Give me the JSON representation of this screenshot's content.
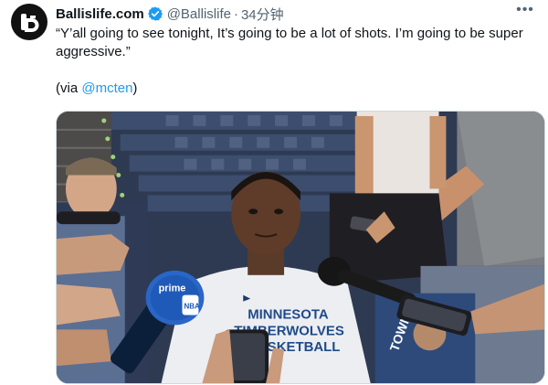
{
  "tweet": {
    "author_name": "Ballislife.com",
    "handle": "@Ballislife",
    "separator": "·",
    "time": "34分钟",
    "more_icon": "more-horizontal-icon",
    "verified_icon": "verified-badge-icon",
    "verified_color": "#1d9bf0",
    "text_line": "“Y’all going to see tonight, It’s going to be a lot of shots. I’m going to be super aggressive.”",
    "via_prefix": "(via ",
    "via_mention": "@mcten",
    "via_suffix": ")",
    "mention_color": "#1d9bf0"
  },
  "media": {
    "shirt_text_line1": "MINNESOTA",
    "shirt_text_line2": "TIMBERWOLVES",
    "shirt_text_line3": "BASKETBALL",
    "mic_flag_text": "prime",
    "mic_logo_text": "NBA"
  }
}
